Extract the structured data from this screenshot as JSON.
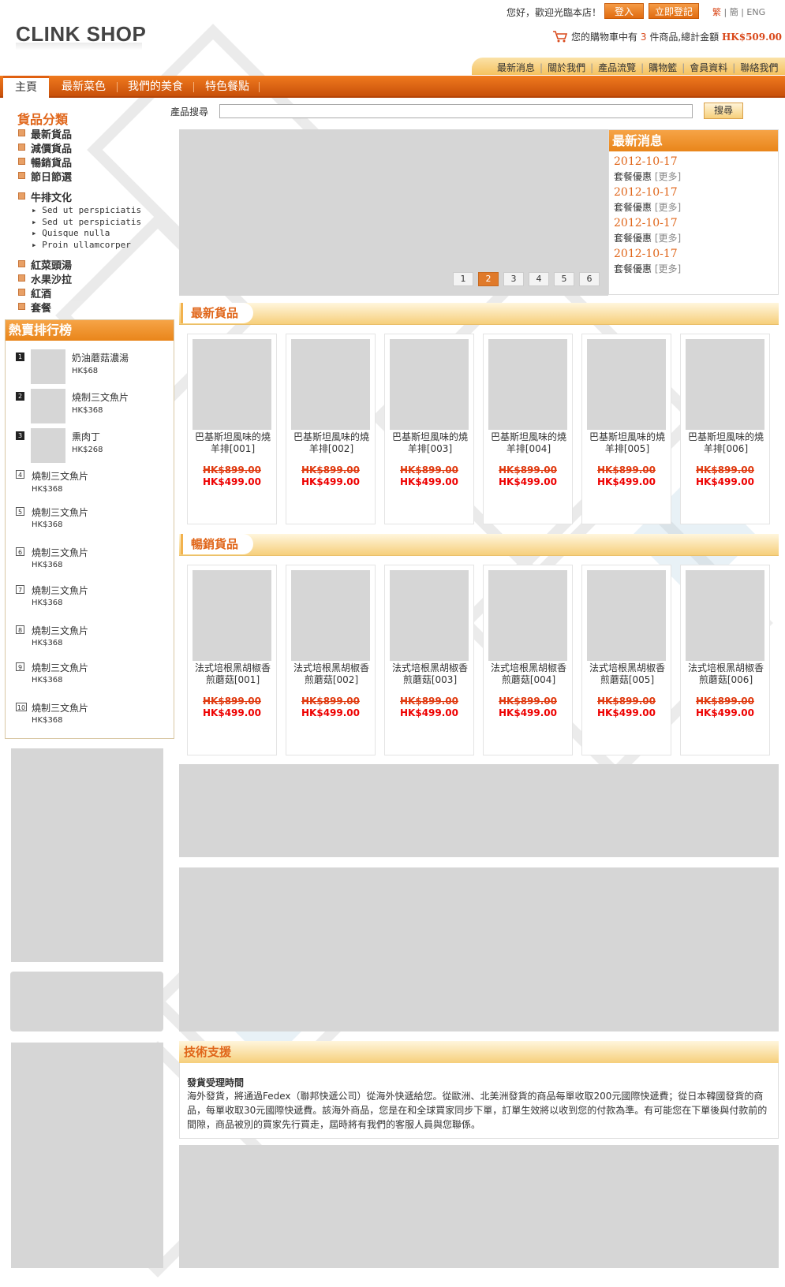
{
  "header": {
    "logo": "CLINK SHOP",
    "greeting": "您好，歡迎光臨本店！",
    "login_label": "登入",
    "register_label": "立即登記",
    "lang": [
      "繁",
      "簡",
      "ENG"
    ],
    "cart_prefix": "您的購物車中有",
    "cart_count": "3",
    "cart_mid": "件商品,總計金額",
    "cart_total": "HK$509.00",
    "top_links": [
      "最新消息",
      "關於我們",
      "產品流覽",
      "購物籃",
      "會員資料",
      "聯絡我們"
    ]
  },
  "main_nav": {
    "tabs": [
      "主頁",
      "最新菜色",
      "我們的美食",
      "特色餐點"
    ],
    "active": "主頁"
  },
  "sidebar": {
    "category_title": "貨品分類",
    "categories_top": [
      "最新貨品",
      "減價貨品",
      "暢銷貨品",
      "節日節選"
    ],
    "steak_label": "牛排文化",
    "steak_subs": [
      "Sed ut perspiciatis",
      "Sed ut perspiciatis",
      "Quisque nulla",
      "Proin ullamcorper"
    ],
    "categories_bottom": [
      "紅菜頭湯",
      "水果沙拉",
      "紅酒",
      "套餐"
    ],
    "ranking_title": "熱賣排行榜",
    "ranking": [
      {
        "n": "1",
        "name": "奶油蘑菇濃湯",
        "price": "HK$68"
      },
      {
        "n": "2",
        "name": "燒制三文魚片",
        "price": "HK$368"
      },
      {
        "n": "3",
        "name": "熏肉丁",
        "price": "HK$268"
      },
      {
        "n": "4",
        "name": "燒制三文魚片",
        "price": "HK$368"
      },
      {
        "n": "5",
        "name": "燒制三文魚片",
        "price": "HK$368"
      },
      {
        "n": "6",
        "name": "燒制三文魚片",
        "price": "HK$368"
      },
      {
        "n": "7",
        "name": "燒制三文魚片",
        "price": "HK$368"
      },
      {
        "n": "8",
        "name": "燒制三文魚片",
        "price": "HK$368"
      },
      {
        "n": "9",
        "name": "燒制三文魚片",
        "price": "HK$368"
      },
      {
        "n": "10",
        "name": "燒制三文魚片",
        "price": "HK$368"
      }
    ]
  },
  "search": {
    "label": "產品搜尋",
    "value": "",
    "button": "搜尋"
  },
  "slider": {
    "pages": [
      "1",
      "2",
      "3",
      "4",
      "5",
      "6"
    ],
    "active": "2"
  },
  "news": {
    "title": "最新消息",
    "items": [
      {
        "date": "2012-10-17",
        "text": "套餐優惠",
        "more": "[更多]"
      },
      {
        "date": "2012-10-17",
        "text": "套餐優惠",
        "more": "[更多]"
      },
      {
        "date": "2012-10-17",
        "text": "套餐優惠",
        "more": "[更多]"
      },
      {
        "date": "2012-10-17",
        "text": "套餐優惠",
        "more": "[更多]"
      }
    ]
  },
  "latest": {
    "title": "最新貨品",
    "items": [
      {
        "name": "巴基斯坦風味的燒羊排[001]",
        "old": "HK$899.00",
        "new": "HK$499.00"
      },
      {
        "name": "巴基斯坦風味的燒羊排[002]",
        "old": "HK$899.00",
        "new": "HK$499.00"
      },
      {
        "name": "巴基斯坦風味的燒羊排[003]",
        "old": "HK$899.00",
        "new": "HK$499.00"
      },
      {
        "name": "巴基斯坦風味的燒羊排[004]",
        "old": "HK$899.00",
        "new": "HK$499.00"
      },
      {
        "name": "巴基斯坦風味的燒羊排[005]",
        "old": "HK$899.00",
        "new": "HK$499.00"
      },
      {
        "name": "巴基斯坦風味的燒羊排[006]",
        "old": "HK$899.00",
        "new": "HK$499.00"
      }
    ]
  },
  "bestseller": {
    "title": "暢銷貨品",
    "items": [
      {
        "name": "法式培根黑胡椒香煎蘑菇[001]",
        "old": "HK$899.00",
        "new": "HK$499.00"
      },
      {
        "name": "法式培根黑胡椒香煎蘑菇[002]",
        "old": "HK$899.00",
        "new": "HK$499.00"
      },
      {
        "name": "法式培根黑胡椒香煎蘑菇[003]",
        "old": "HK$899.00",
        "new": "HK$499.00"
      },
      {
        "name": "法式培根黑胡椒香煎蘑菇[004]",
        "old": "HK$899.00",
        "new": "HK$499.00"
      },
      {
        "name": "法式培根黑胡椒香煎蘑菇[005]",
        "old": "HK$899.00",
        "new": "HK$499.00"
      },
      {
        "name": "法式培根黑胡椒香煎蘑菇[006]",
        "old": "HK$899.00",
        "new": "HK$499.00"
      }
    ]
  },
  "support": {
    "title": "技術支援",
    "subtitle": "發貨受理時間",
    "text": "海外發貨，將通過Fedex（聯邦快遞公司）從海外快遞給您。從歐洲、北美洲發貨的商品每單收取200元國際快遞費；從日本韓國發貨的商品，每單收取30元國際快遞費。該海外商品，您是在和全球買家同步下單，訂單生效將以收到您的付款為準。有可能您在下單後與付款前的間隙，商品被別的買家先行買走，屆時將有我們的客服人員與您聯係。"
  },
  "colors": {
    "accent": "#e0661a",
    "nav": "#d9580e",
    "placeholder": "#d6d6d6"
  }
}
